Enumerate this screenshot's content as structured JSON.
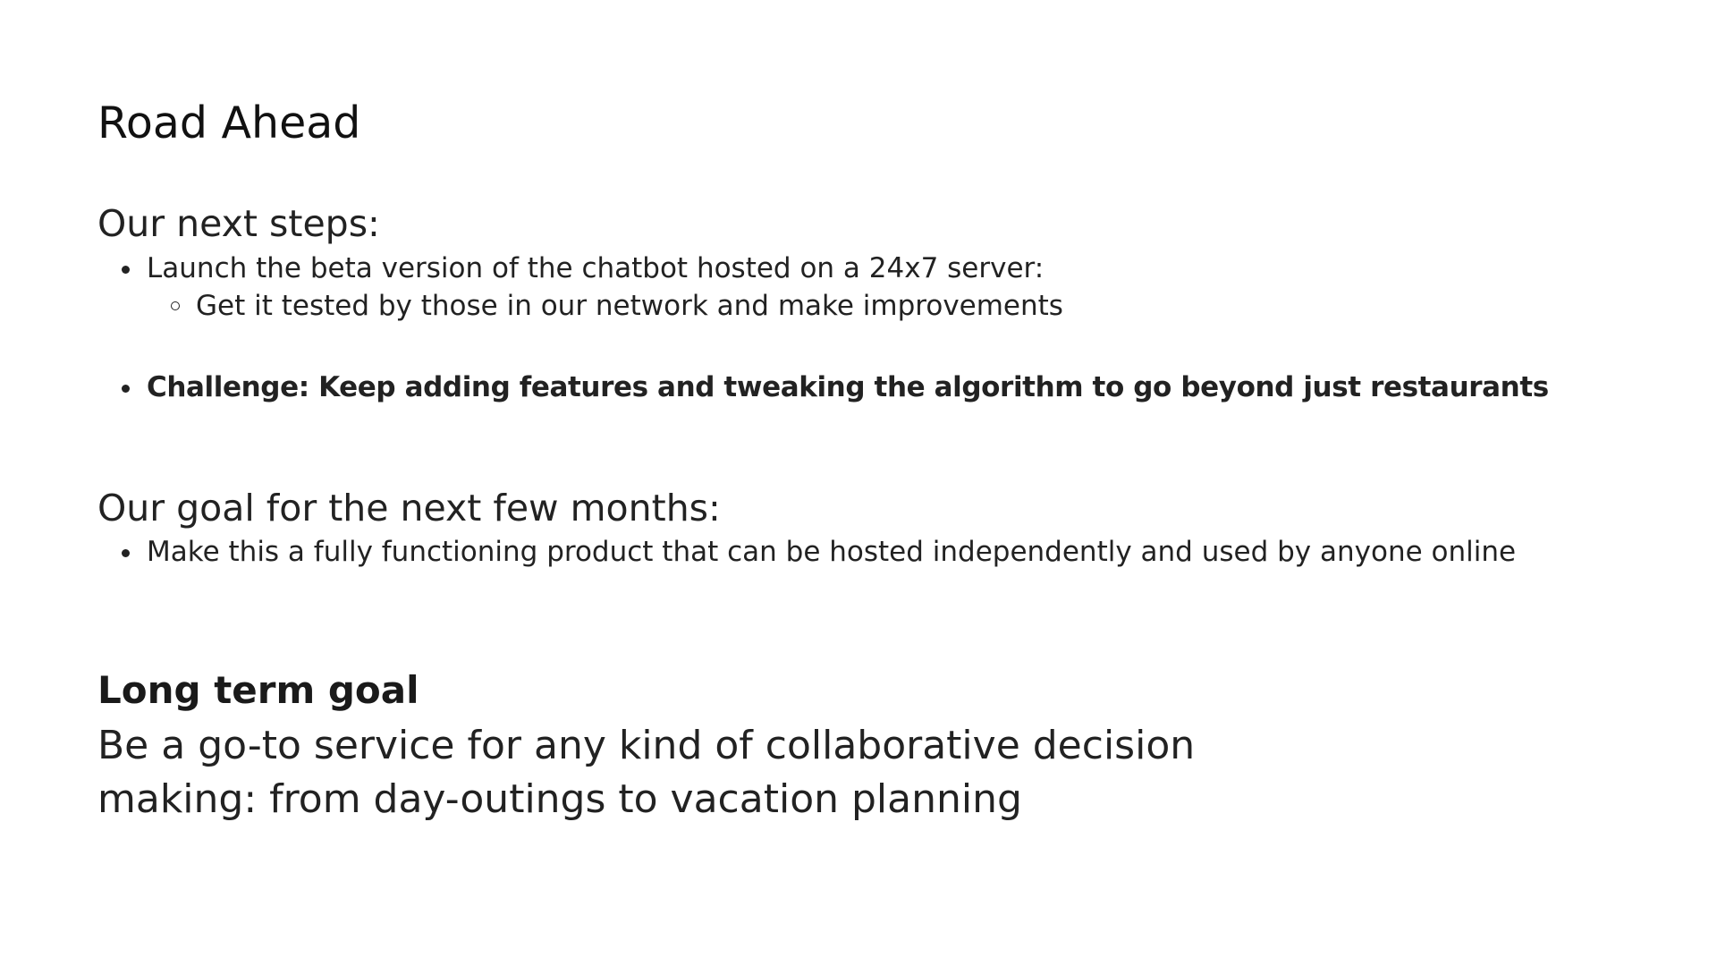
{
  "slide": {
    "title": "Road Ahead",
    "next_steps": {
      "heading": "Our next steps:",
      "item1": "Launch the beta version of the chatbot hosted on a 24x7 server:",
      "item1_sub": "Get it tested by those in our network and make improvements",
      "item2": "Challenge: Keep adding features and tweaking the algorithm to go beyond just restaurants"
    },
    "goal": {
      "heading": "Our goal for the next few months:",
      "item1": "Make this a fully functioning product that can be hosted independently and used by anyone online"
    },
    "long_term": {
      "heading": "Long term goal",
      "body_line1": "Be a go-to service for any kind of collaborative decision",
      "body_line2": "making: from day-outings to vacation planning"
    }
  }
}
